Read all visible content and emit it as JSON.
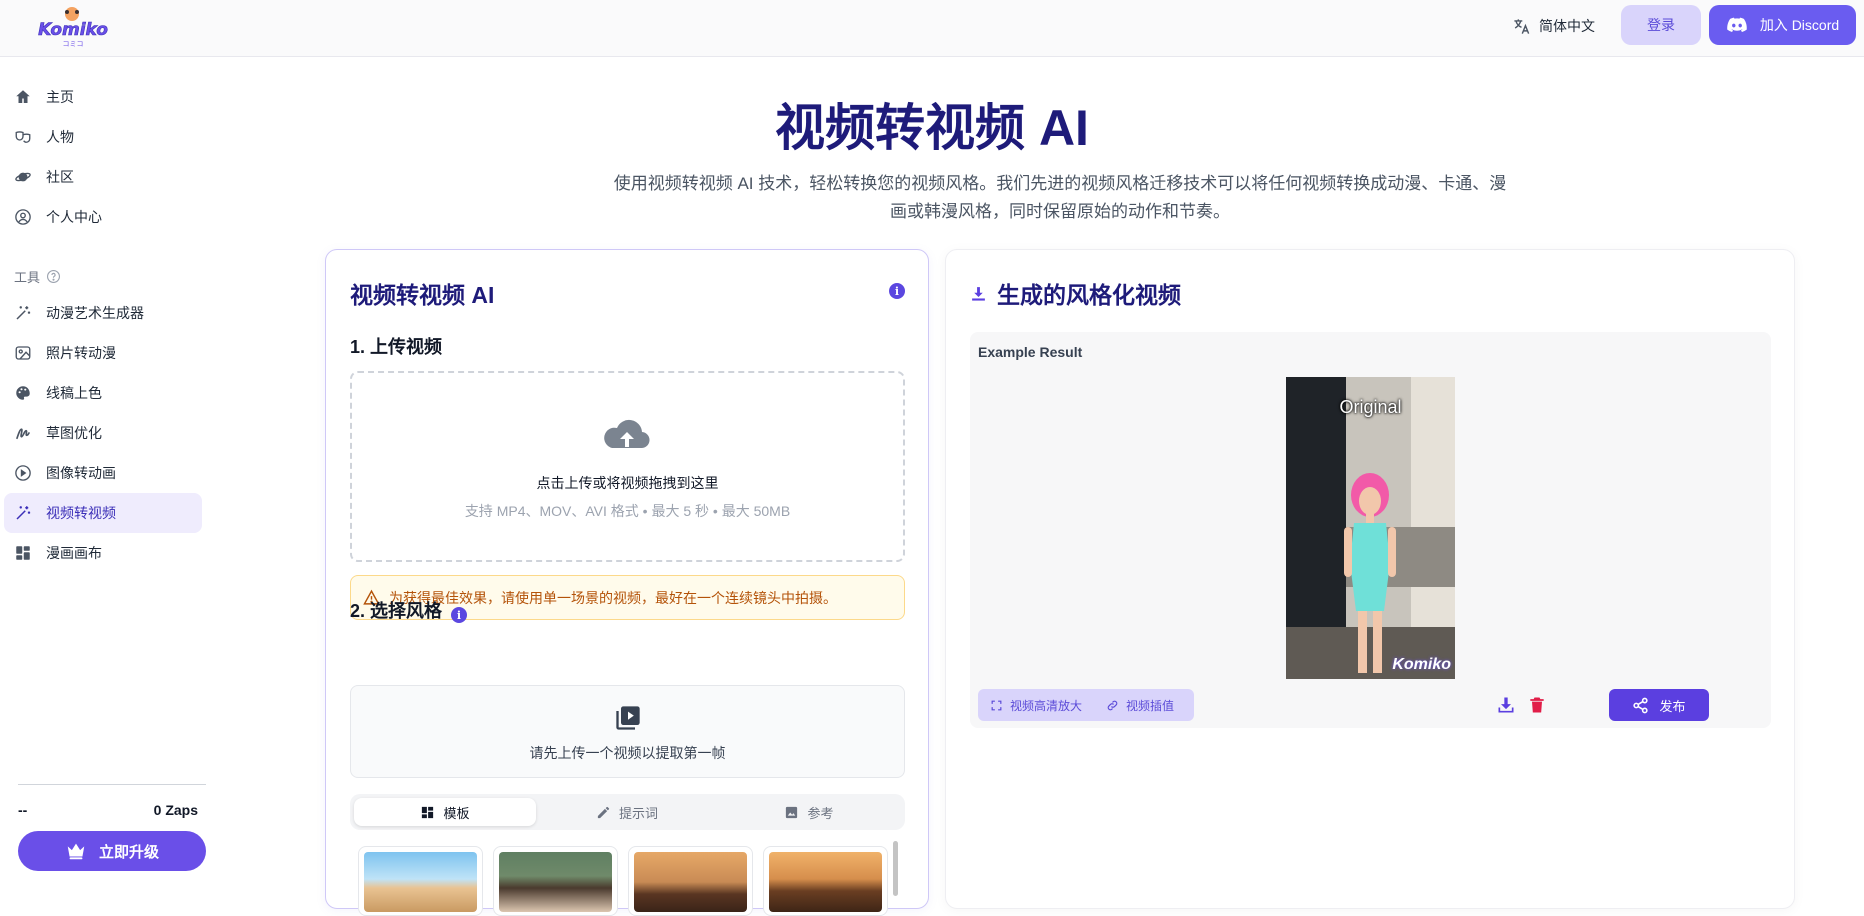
{
  "header": {
    "logo_text": "Komiko",
    "language": "简体中文",
    "login": "登录",
    "discord": "加入 Discord"
  },
  "sidebar": {
    "items": [
      {
        "label": "主页",
        "icon": "home-icon"
      },
      {
        "label": "人物",
        "icon": "masks-icon"
      },
      {
        "label": "社区",
        "icon": "planet-icon"
      },
      {
        "label": "个人中心",
        "icon": "user-circle-icon"
      }
    ],
    "tools_label": "工具",
    "tools": [
      {
        "label": "动漫艺术生成器",
        "icon": "magic-wand-icon"
      },
      {
        "label": "照片转动漫",
        "icon": "photo-icon"
      },
      {
        "label": "线稿上色",
        "icon": "palette-icon"
      },
      {
        "label": "草图优化",
        "icon": "sketch-icon"
      },
      {
        "label": "图像转动画",
        "icon": "play-circle-icon"
      },
      {
        "label": "视频转视频",
        "icon": "magic-wand-icon",
        "active": true
      },
      {
        "label": "漫画画布",
        "icon": "dashboard-icon"
      }
    ],
    "user_name": "--",
    "zaps": "0 Zaps",
    "upgrade": "立即升级"
  },
  "hero": {
    "title": "视频转视频 AI",
    "description": "使用视频转视频 AI 技术，轻松转换您的视频风格。我们先进的视频风格迁移技术可以将任何视频转换成动漫、卡通、漫画或韩漫风格，同时保留原始的动作和节奏。"
  },
  "left_card": {
    "title": "视频转视频 AI",
    "step1": "1. 上传视频",
    "upload_main": "点击上传或将视频拖拽到这里",
    "upload_sub": "支持 MP4、MOV、AVI 格式 • 最大 5 秒 • 最大 50MB",
    "warning": "为获得最佳效果，请使用单一场景的视频，最好在一个连续镜头中拍摄。",
    "step2": "2. 选择风格",
    "frame_hint": "请先上传一个视频以提取第一帧",
    "tabs": [
      {
        "label": "模板",
        "icon": "grid-icon",
        "active": true
      },
      {
        "label": "提示词",
        "icon": "pencil-icon"
      },
      {
        "label": "参考",
        "icon": "image-icon"
      }
    ]
  },
  "right_card": {
    "title": "生成的风格化视频",
    "example_label": "Example Result",
    "video_caption": "Original",
    "watermark": "Komiko",
    "upscale": "视频高清放大",
    "interpolate": "视频插值",
    "publish": "发布"
  },
  "colors": {
    "brand": "#6a4fe8",
    "title": "#1e1b7a",
    "warning_text": "#b45309",
    "delete": "#e11d48"
  }
}
